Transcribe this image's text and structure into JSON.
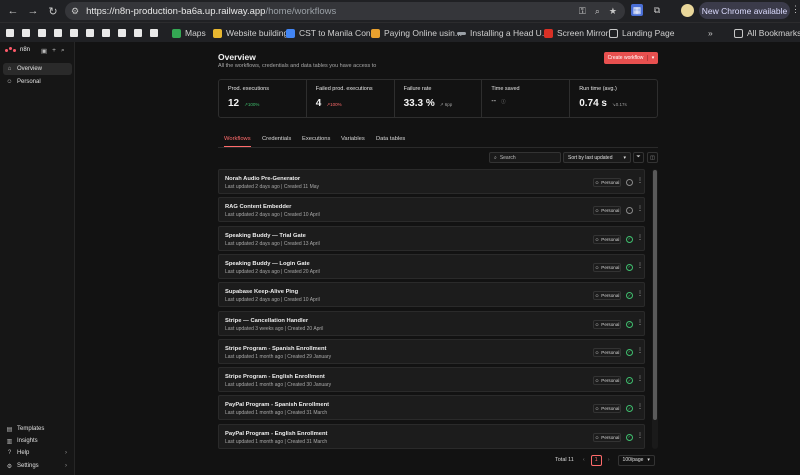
{
  "browser": {
    "url_host": "https://n8n-production-ba6a.up.railway.app",
    "url_path": "/home/workflows",
    "update_button": "New Chrome available",
    "bookmarks": [
      {
        "label": "Maps",
        "color": "#34a853"
      },
      {
        "label": "Website building",
        "color": "#e8b730"
      },
      {
        "label": "CST to Manila Con...",
        "color": "#4285f4"
      },
      {
        "label": "Paying Online usin...",
        "color": "#e8a02e"
      },
      {
        "label": "Installing a Head U...",
        "color": "#9aa0a6"
      },
      {
        "label": "Screen Mirror",
        "color": "#d93025"
      },
      {
        "label": "Landing Page",
        "color": "#c8c8c8"
      }
    ],
    "all_bookmarks": "All Bookmarks"
  },
  "sidebar": {
    "brand": "n8n",
    "top_items": [
      {
        "label": "Overview",
        "icon": "home-icon"
      },
      {
        "label": "Personal",
        "icon": "user-icon"
      }
    ],
    "bottom_items": [
      {
        "label": "Templates",
        "icon": "templates-icon"
      },
      {
        "label": "Insights",
        "icon": "chart-icon"
      },
      {
        "label": "Help",
        "icon": "help-icon"
      },
      {
        "label": "Settings",
        "icon": "gear-icon"
      }
    ]
  },
  "overview": {
    "title": "Overview",
    "subtitle": "All the workflows, credentials and data tables you have access to",
    "create_button": "Create workflow"
  },
  "stats": [
    {
      "label": "Prod. executions",
      "value": "12",
      "delta": "↗100%",
      "tone": "up"
    },
    {
      "label": "Failed prod. executions",
      "value": "4",
      "delta": "↗100%",
      "tone": "bad"
    },
    {
      "label": "Failure rate",
      "value": "33.3 %",
      "delta": "↗ 6pp",
      "tone": "muted"
    },
    {
      "label": "Time saved",
      "value": "--",
      "delta": "",
      "tone": "muted"
    },
    {
      "label": "Run time (avg.)",
      "value": "0.74 s",
      "delta": "↘0.17s",
      "tone": "muted"
    }
  ],
  "tabs": [
    {
      "label": "Workflows",
      "active": true
    },
    {
      "label": "Credentials",
      "active": false
    },
    {
      "label": "Executions",
      "active": false
    },
    {
      "label": "Variables",
      "active": false
    },
    {
      "label": "Data tables",
      "active": false
    }
  ],
  "toolbar": {
    "search_placeholder": "Search",
    "sort_label": "Sort by last updated"
  },
  "workflows": [
    {
      "name": "Norah Audio Pre-Generator",
      "updated": "Last updated 2 days ago",
      "created": "Created 11 May",
      "owner": "Personal",
      "active": false
    },
    {
      "name": "RAG Content Embedder",
      "updated": "Last updated 2 days ago",
      "created": "Created 10 April",
      "owner": "Personal",
      "active": false
    },
    {
      "name": "Speaking Buddy — Trial Gate",
      "updated": "Last updated 2 days ago",
      "created": "Created 13 April",
      "owner": "Personal",
      "active": true
    },
    {
      "name": "Speaking Buddy — Login Gate",
      "updated": "Last updated 2 days ago",
      "created": "Created 20 April",
      "owner": "Personal",
      "active": true
    },
    {
      "name": "Supabase Keep-Alive Ping",
      "updated": "Last updated 2 days ago",
      "created": "Created 10 April",
      "owner": "Personal",
      "active": true
    },
    {
      "name": "Stripe — Cancellation Handler",
      "updated": "Last updated 3 weeks ago",
      "created": "Created 20 April",
      "owner": "Personal",
      "active": true
    },
    {
      "name": "Stripe Program - Spanish Enrollment",
      "updated": "Last updated 1 month ago",
      "created": "Created 29 January",
      "owner": "Personal",
      "active": true
    },
    {
      "name": "Stripe Program - English Enrollment",
      "updated": "Last updated 1 month ago",
      "created": "Created 30 January",
      "owner": "Personal",
      "active": true
    },
    {
      "name": "PayPal Program - Spanish Enrollment",
      "updated": "Last updated 1 month ago",
      "created": "Created 31 March",
      "owner": "Personal",
      "active": true
    },
    {
      "name": "PayPal Program - English Enrollment",
      "updated": "Last updated 1 month ago",
      "created": "Created 31 March",
      "owner": "Personal",
      "active": true
    }
  ],
  "pagination": {
    "total": "Total 11",
    "current_page": "1",
    "page_size": "100/page"
  }
}
